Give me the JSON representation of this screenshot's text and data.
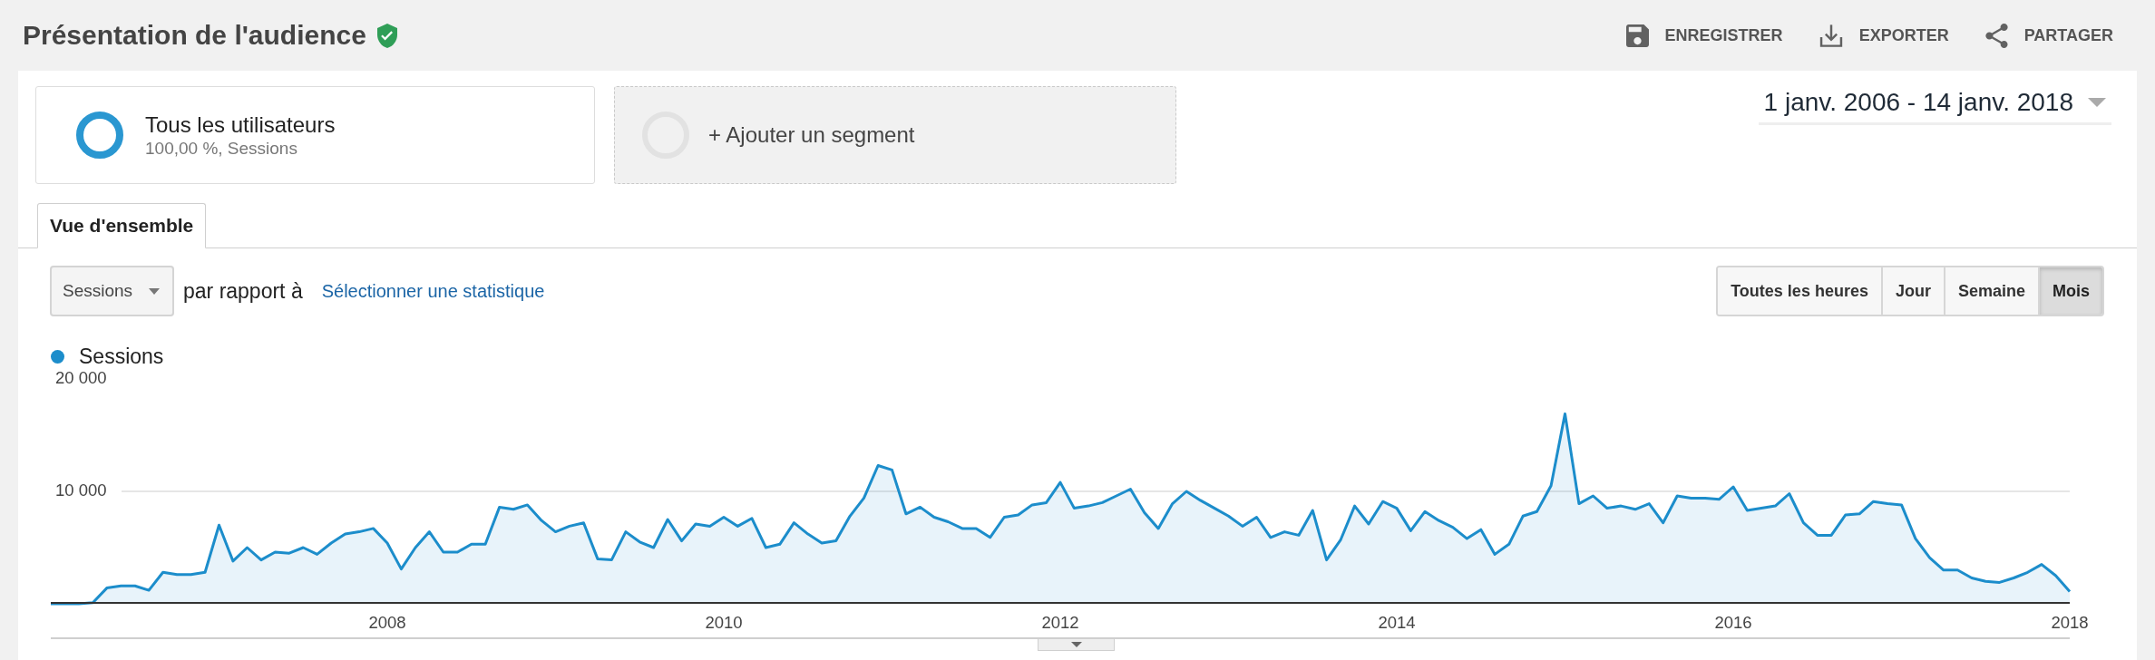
{
  "header": {
    "title": "Présentation de l'audience",
    "verified": true,
    "actions": [
      {
        "kind": "save",
        "label": "ENREGISTRER"
      },
      {
        "kind": "export",
        "label": "EXPORTER"
      },
      {
        "kind": "share",
        "label": "PARTAGER"
      }
    ]
  },
  "segments": [
    {
      "kind": "segment",
      "name": "Tous les utilisateurs",
      "detail": "100,00 %, Sessions"
    },
    {
      "kind": "add",
      "name": "+ Ajouter un segment"
    }
  ],
  "date_range": {
    "value": "1 janv. 2006 - 14 janv. 2018"
  },
  "tabs": [
    {
      "label": "Vue d'ensemble",
      "selected": true
    }
  ],
  "controls": {
    "metric": "Sessions",
    "compare_label": "par rapport à",
    "compare_link": "Sélectionner une statistique",
    "granularity": [
      {
        "label": "Toutes les heures",
        "selected": false
      },
      {
        "label": "Jour",
        "selected": false
      },
      {
        "label": "Semaine",
        "selected": false
      },
      {
        "label": "Mois",
        "selected": true
      }
    ]
  },
  "chart": {
    "chart_data": {
      "type": "area",
      "x": [
        2006,
        2006.083,
        2006.167,
        2006.25,
        2006.333,
        2006.417,
        2006.5,
        2006.583,
        2006.667,
        2006.75,
        2006.833,
        2006.917,
        2007,
        2007.083,
        2007.167,
        2007.25,
        2007.333,
        2007.417,
        2007.5,
        2007.583,
        2007.667,
        2007.75,
        2007.833,
        2007.917,
        2008,
        2008.083,
        2008.167,
        2008.25,
        2008.333,
        2008.417,
        2008.5,
        2008.583,
        2008.667,
        2008.75,
        2008.833,
        2008.917,
        2009,
        2009.083,
        2009.167,
        2009.25,
        2009.333,
        2009.417,
        2009.5,
        2009.583,
        2009.667,
        2009.75,
        2009.833,
        2009.917,
        2010,
        2010.083,
        2010.167,
        2010.25,
        2010.333,
        2010.417,
        2010.5,
        2010.583,
        2010.667,
        2010.75,
        2010.833,
        2010.917,
        2011,
        2011.083,
        2011.167,
        2011.25,
        2011.333,
        2011.417,
        2011.5,
        2011.583,
        2011.667,
        2011.75,
        2011.833,
        2011.917,
        2012,
        2012.083,
        2012.167,
        2012.25,
        2012.333,
        2012.417,
        2012.5,
        2012.583,
        2012.667,
        2012.75,
        2012.833,
        2012.917,
        2013,
        2013.083,
        2013.167,
        2013.25,
        2013.333,
        2013.417,
        2013.5,
        2013.583,
        2013.667,
        2013.75,
        2013.833,
        2013.917,
        2014,
        2014.083,
        2014.167,
        2014.25,
        2014.333,
        2014.417,
        2014.5,
        2014.583,
        2014.667,
        2014.75,
        2014.833,
        2014.917,
        2015,
        2015.083,
        2015.167,
        2015.25,
        2015.333,
        2015.417,
        2015.5,
        2015.583,
        2015.667,
        2015.75,
        2015.833,
        2015.917,
        2016,
        2016.083,
        2016.167,
        2016.25,
        2016.333,
        2016.417,
        2016.5,
        2016.583,
        2016.667,
        2016.75,
        2016.833,
        2016.917,
        2017,
        2017.083,
        2017.167,
        2017.25,
        2017.333,
        2017.417,
        2017.5,
        2017.583,
        2017.667,
        2017.75,
        2017.833,
        2017.917,
        2018
      ],
      "series": [
        {
          "name": "Sessions",
          "color": "#1c8dcb",
          "values": [
            0,
            0,
            0,
            100,
            1400,
            1600,
            1600,
            1200,
            2800,
            2600,
            2600,
            2800,
            7000,
            3800,
            5000,
            3900,
            4600,
            4500,
            5000,
            4400,
            5400,
            6200,
            6400,
            6700,
            5400,
            3100,
            5000,
            6400,
            4600,
            4600,
            5300,
            5300,
            8600,
            8400,
            8800,
            7400,
            6400,
            6900,
            7200,
            4000,
            3900,
            6400,
            5500,
            5000,
            7500,
            5600,
            7100,
            6900,
            7700,
            6900,
            7600,
            5000,
            5300,
            7200,
            6200,
            5400,
            5600,
            7800,
            9400,
            12300,
            11900,
            8000,
            8600,
            7700,
            7300,
            6700,
            6700,
            5900,
            7700,
            7900,
            8800,
            9000,
            10800,
            8500,
            8700,
            9000,
            9600,
            10200,
            8100,
            6700,
            8900,
            10000,
            9200,
            8500,
            7800,
            6900,
            7700,
            5900,
            6400,
            6100,
            8300,
            3900,
            5700,
            8700,
            7100,
            9100,
            8500,
            6500,
            8200,
            7400,
            6800,
            5800,
            6600,
            4400,
            5300,
            7800,
            8200,
            10500,
            16900,
            8900,
            9600,
            8500,
            8700,
            8400,
            8900,
            7200,
            9600,
            9400,
            9400,
            9300,
            10400,
            8300,
            8500,
            8700,
            9800,
            7200,
            6100,
            6100,
            7900,
            8000,
            9100,
            8900,
            8800,
            5800,
            4100,
            3000,
            3000,
            2300,
            2000,
            1900,
            2300,
            2800,
            3500,
            2500,
            1100
          ]
        }
      ],
      "xlim": [
        2006,
        2018
      ],
      "ylim": [
        0,
        20000
      ],
      "xticks": [
        2008,
        2010,
        2012,
        2014,
        2016,
        2018
      ],
      "yticks": [
        {
          "value": 10000,
          "label": "10 000"
        },
        {
          "value": 20000,
          "label": "20 000"
        }
      ]
    }
  }
}
